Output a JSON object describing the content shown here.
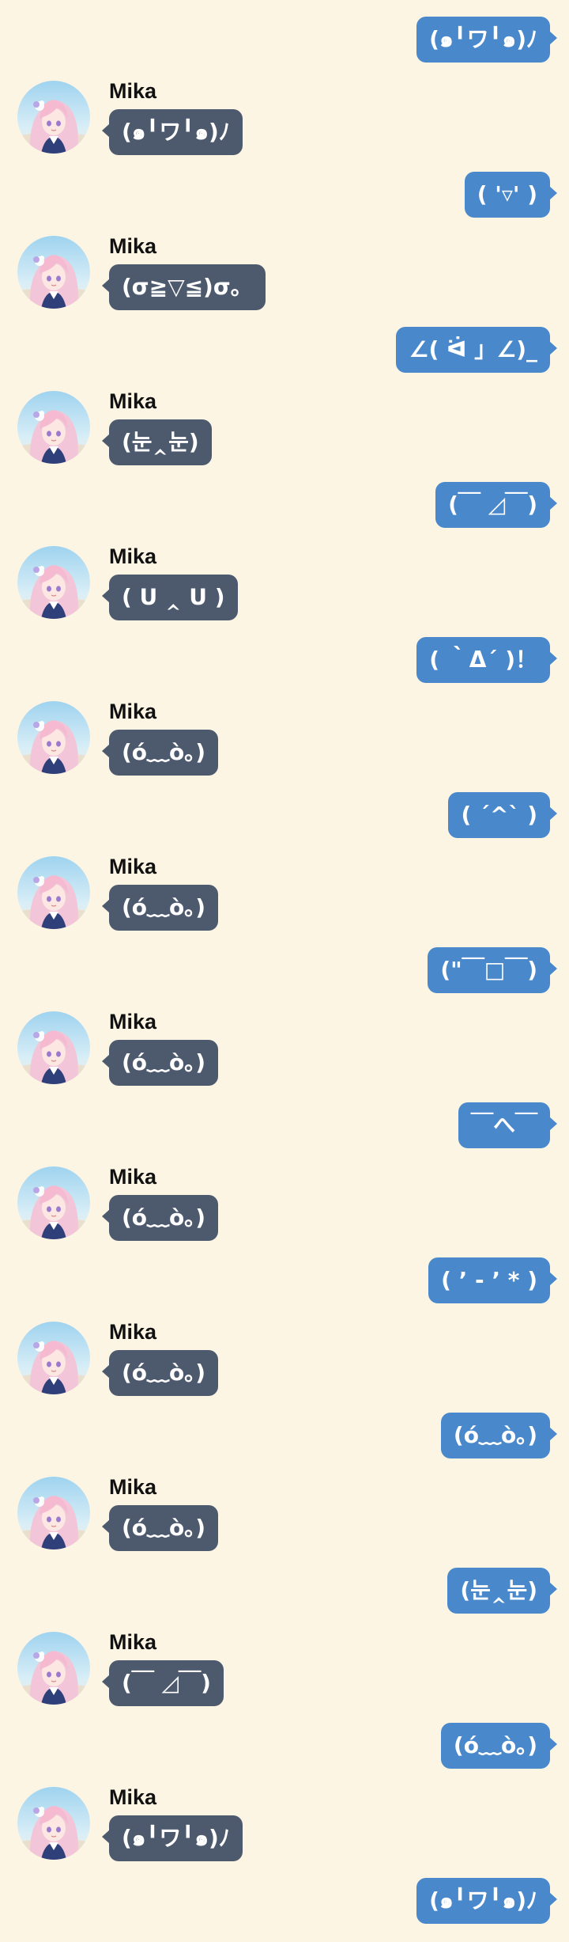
{
  "contact": {
    "name": "Mika"
  },
  "colors": {
    "background": "#fdf5e4",
    "sent_bubble": "#4a88cc",
    "received_bubble": "#4d5a6e",
    "name_text": "#111111"
  },
  "messages": [
    {
      "sender": "me",
      "text": "(๑╹ワ╹๑)ﾉ"
    },
    {
      "sender": "Mika",
      "text": "(๑╹ワ╹๑)ﾉ"
    },
    {
      "sender": "me",
      "text": "( '▿' )"
    },
    {
      "sender": "Mika",
      "text": "(σ≧▽≦)σ。"
    },
    {
      "sender": "me",
      "text": "∠( ᐛ 」∠)_"
    },
    {
      "sender": "Mika",
      "text": "(눈‸눈)"
    },
    {
      "sender": "me",
      "text": "(￣ ◿￣)"
    },
    {
      "sender": "Mika",
      "text": "( ᑌ ‸ ᑌ )"
    },
    {
      "sender": "me",
      "text": "( ｀Δ´ )！"
    },
    {
      "sender": "Mika",
      "text": "(ó﹏ò｡)"
    },
    {
      "sender": "me",
      "text": "( ´^` )"
    },
    {
      "sender": "Mika",
      "text": "(ó﹏ò｡)"
    },
    {
      "sender": "me",
      "text": "(\"￣□￣)"
    },
    {
      "sender": "Mika",
      "text": "(ó﹏ò｡)"
    },
    {
      "sender": "me",
      "text": "￣へ￣"
    },
    {
      "sender": "Mika",
      "text": "(ó﹏ò｡)"
    },
    {
      "sender": "me",
      "text": "( ’ - ’ * )"
    },
    {
      "sender": "Mika",
      "text": "(ó﹏ò｡)"
    },
    {
      "sender": "me",
      "text": "(ó﹏ò｡)"
    },
    {
      "sender": "Mika",
      "text": "(ó﹏ò｡)"
    },
    {
      "sender": "me",
      "text": "(눈‸눈)"
    },
    {
      "sender": "Mika",
      "text": "(￣ ◿￣)"
    },
    {
      "sender": "me",
      "text": "(ó﹏ò｡)"
    },
    {
      "sender": "Mika",
      "text": "(๑╹ワ╹๑)ﾉ"
    },
    {
      "sender": "me",
      "text": "(๑╹ワ╹๑)ﾉ"
    }
  ]
}
